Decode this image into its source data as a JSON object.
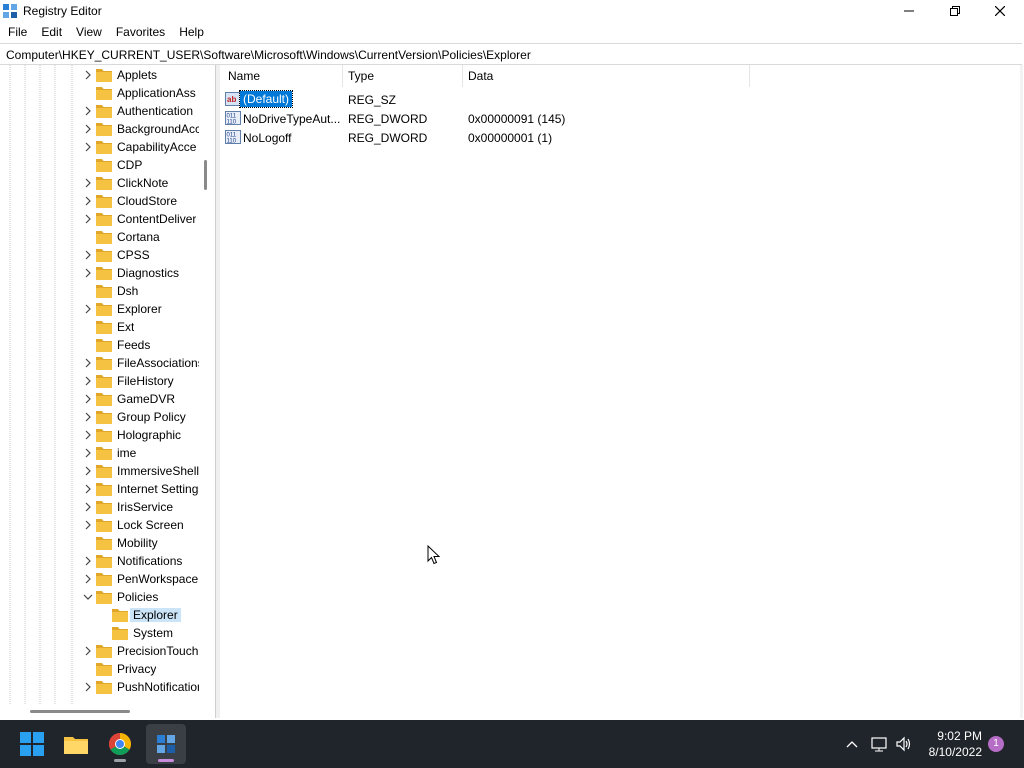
{
  "window": {
    "title": "Registry Editor"
  },
  "menu": [
    "File",
    "Edit",
    "View",
    "Favorites",
    "Help"
  ],
  "address": "Computer\\HKEY_CURRENT_USER\\Software\\Microsoft\\Windows\\CurrentVersion\\Policies\\Explorer",
  "tree": [
    {
      "label": "Applets",
      "expand": true,
      "level": 0
    },
    {
      "label": "ApplicationAss",
      "expand": false,
      "level": 0
    },
    {
      "label": "Authentication",
      "expand": true,
      "level": 0
    },
    {
      "label": "BackgroundAcc",
      "expand": true,
      "level": 0
    },
    {
      "label": "CapabilityAcce",
      "expand": true,
      "level": 0
    },
    {
      "label": "CDP",
      "expand": false,
      "level": 0
    },
    {
      "label": "ClickNote",
      "expand": true,
      "level": 0
    },
    {
      "label": "CloudStore",
      "expand": true,
      "level": 0
    },
    {
      "label": "ContentDeliver",
      "expand": true,
      "level": 0
    },
    {
      "label": "Cortana",
      "expand": false,
      "level": 0
    },
    {
      "label": "CPSS",
      "expand": true,
      "level": 0
    },
    {
      "label": "Diagnostics",
      "expand": true,
      "level": 0
    },
    {
      "label": "Dsh",
      "expand": false,
      "level": 0
    },
    {
      "label": "Explorer",
      "expand": true,
      "level": 0
    },
    {
      "label": "Ext",
      "expand": false,
      "level": 0
    },
    {
      "label": "Feeds",
      "expand": false,
      "level": 0
    },
    {
      "label": "FileAssociations",
      "expand": true,
      "level": 0
    },
    {
      "label": "FileHistory",
      "expand": true,
      "level": 0
    },
    {
      "label": "GameDVR",
      "expand": true,
      "level": 0
    },
    {
      "label": "Group Policy",
      "expand": true,
      "level": 0
    },
    {
      "label": "Holographic",
      "expand": true,
      "level": 0
    },
    {
      "label": "ime",
      "expand": true,
      "level": 0
    },
    {
      "label": "ImmersiveShell",
      "expand": true,
      "level": 0
    },
    {
      "label": "Internet Setting",
      "expand": true,
      "level": 0
    },
    {
      "label": "IrisService",
      "expand": true,
      "level": 0
    },
    {
      "label": "Lock Screen",
      "expand": true,
      "level": 0
    },
    {
      "label": "Mobility",
      "expand": false,
      "level": 0
    },
    {
      "label": "Notifications",
      "expand": true,
      "level": 0
    },
    {
      "label": "PenWorkspace",
      "expand": true,
      "level": 0
    },
    {
      "label": "Policies",
      "expand": "open",
      "level": 0
    },
    {
      "label": "Explorer",
      "expand": false,
      "level": 1,
      "selected": true
    },
    {
      "label": "System",
      "expand": false,
      "level": 1
    },
    {
      "label": "PrecisionTouch",
      "expand": true,
      "level": 0
    },
    {
      "label": "Privacy",
      "expand": false,
      "level": 0
    },
    {
      "label": "PushNotification",
      "expand": true,
      "level": 0
    }
  ],
  "columns": {
    "name": "Name",
    "type": "Type",
    "data": "Data"
  },
  "values": [
    {
      "name": "(Default)",
      "type": "REG_SZ",
      "data": "",
      "icon": "string-value-icon",
      "selected": true
    },
    {
      "name": "NoDriveTypeAut...",
      "type": "REG_DWORD",
      "data": "0x00000091 (145)",
      "icon": "dword-value-icon"
    },
    {
      "name": "NoLogoff",
      "type": "REG_DWORD",
      "data": "0x00000001 (1)",
      "icon": "dword-value-icon"
    }
  ],
  "taskbar": {
    "time": "9:02 PM",
    "date": "8/10/2022",
    "notifications": "1",
    "apps": [
      "start-icon",
      "file-explorer-icon",
      "chrome-icon",
      "regedit-icon"
    ]
  },
  "colors": {
    "selection": "#0078d7",
    "tree_selection": "#cce4f7",
    "taskbar": "#20252b",
    "folder": "#f5c242"
  }
}
